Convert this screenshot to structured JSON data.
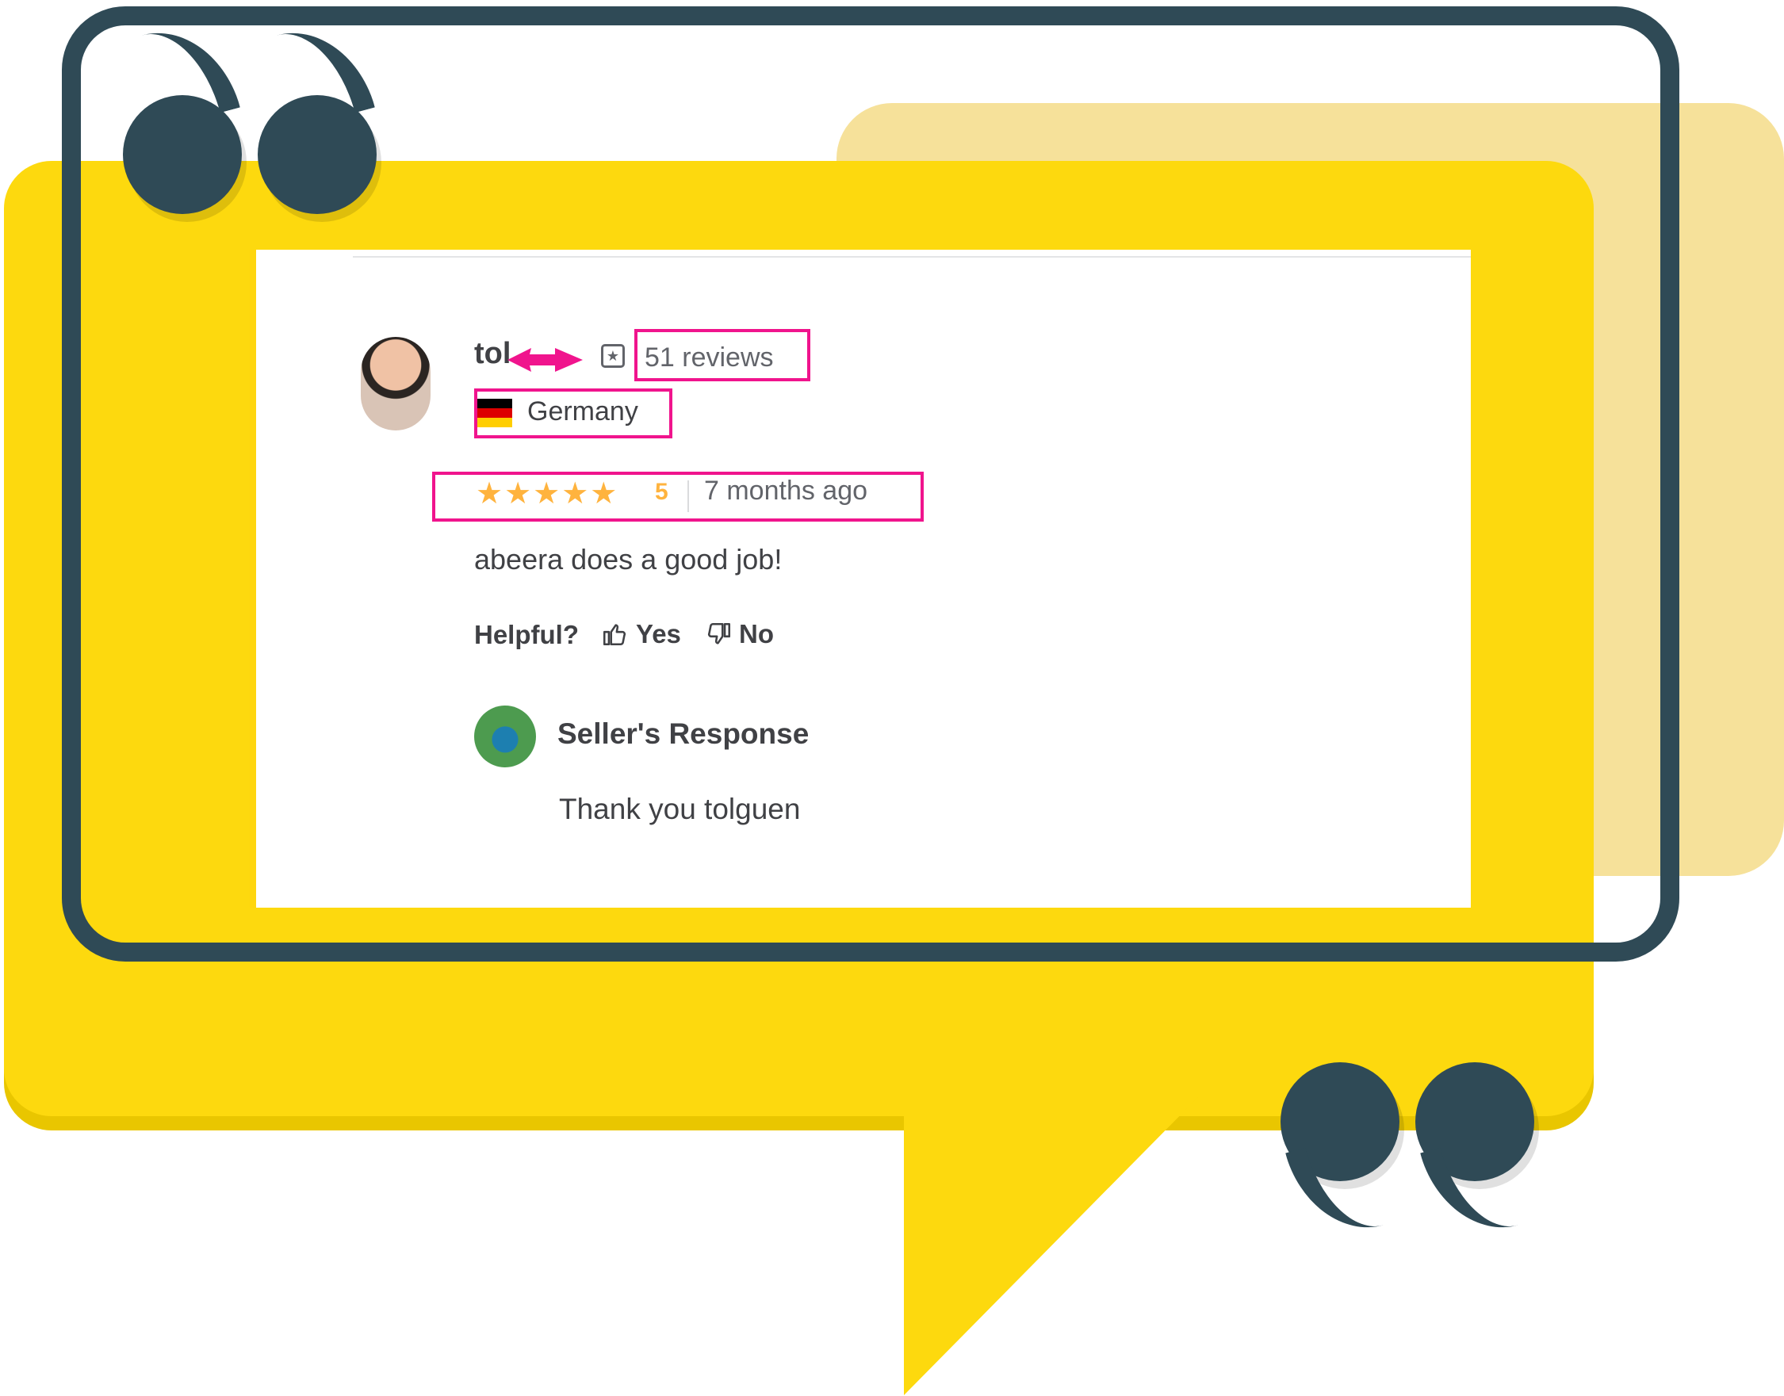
{
  "review": {
    "reviewer_name": "tol",
    "reviews_count": "51 reviews",
    "country": "Germany",
    "rating": "5",
    "stars": "★★★★★",
    "time_ago": "7 months ago",
    "text": "abeera does a good job!"
  },
  "helpful": {
    "label": "Helpful?",
    "yes": "Yes",
    "no": "No"
  },
  "seller_response": {
    "title": "Seller's Response",
    "text": "Thank you tolguen"
  },
  "icons": {
    "badge": "badge-icon",
    "thumbs_up": "thumbs-up-icon",
    "thumbs_down": "thumbs-down-icon",
    "flag": "germany-flag-icon"
  },
  "colors": {
    "highlight": "#f0148d",
    "stars": "#ffb33e",
    "bubble": "#fdd90e",
    "frame": "#2f4a56"
  }
}
